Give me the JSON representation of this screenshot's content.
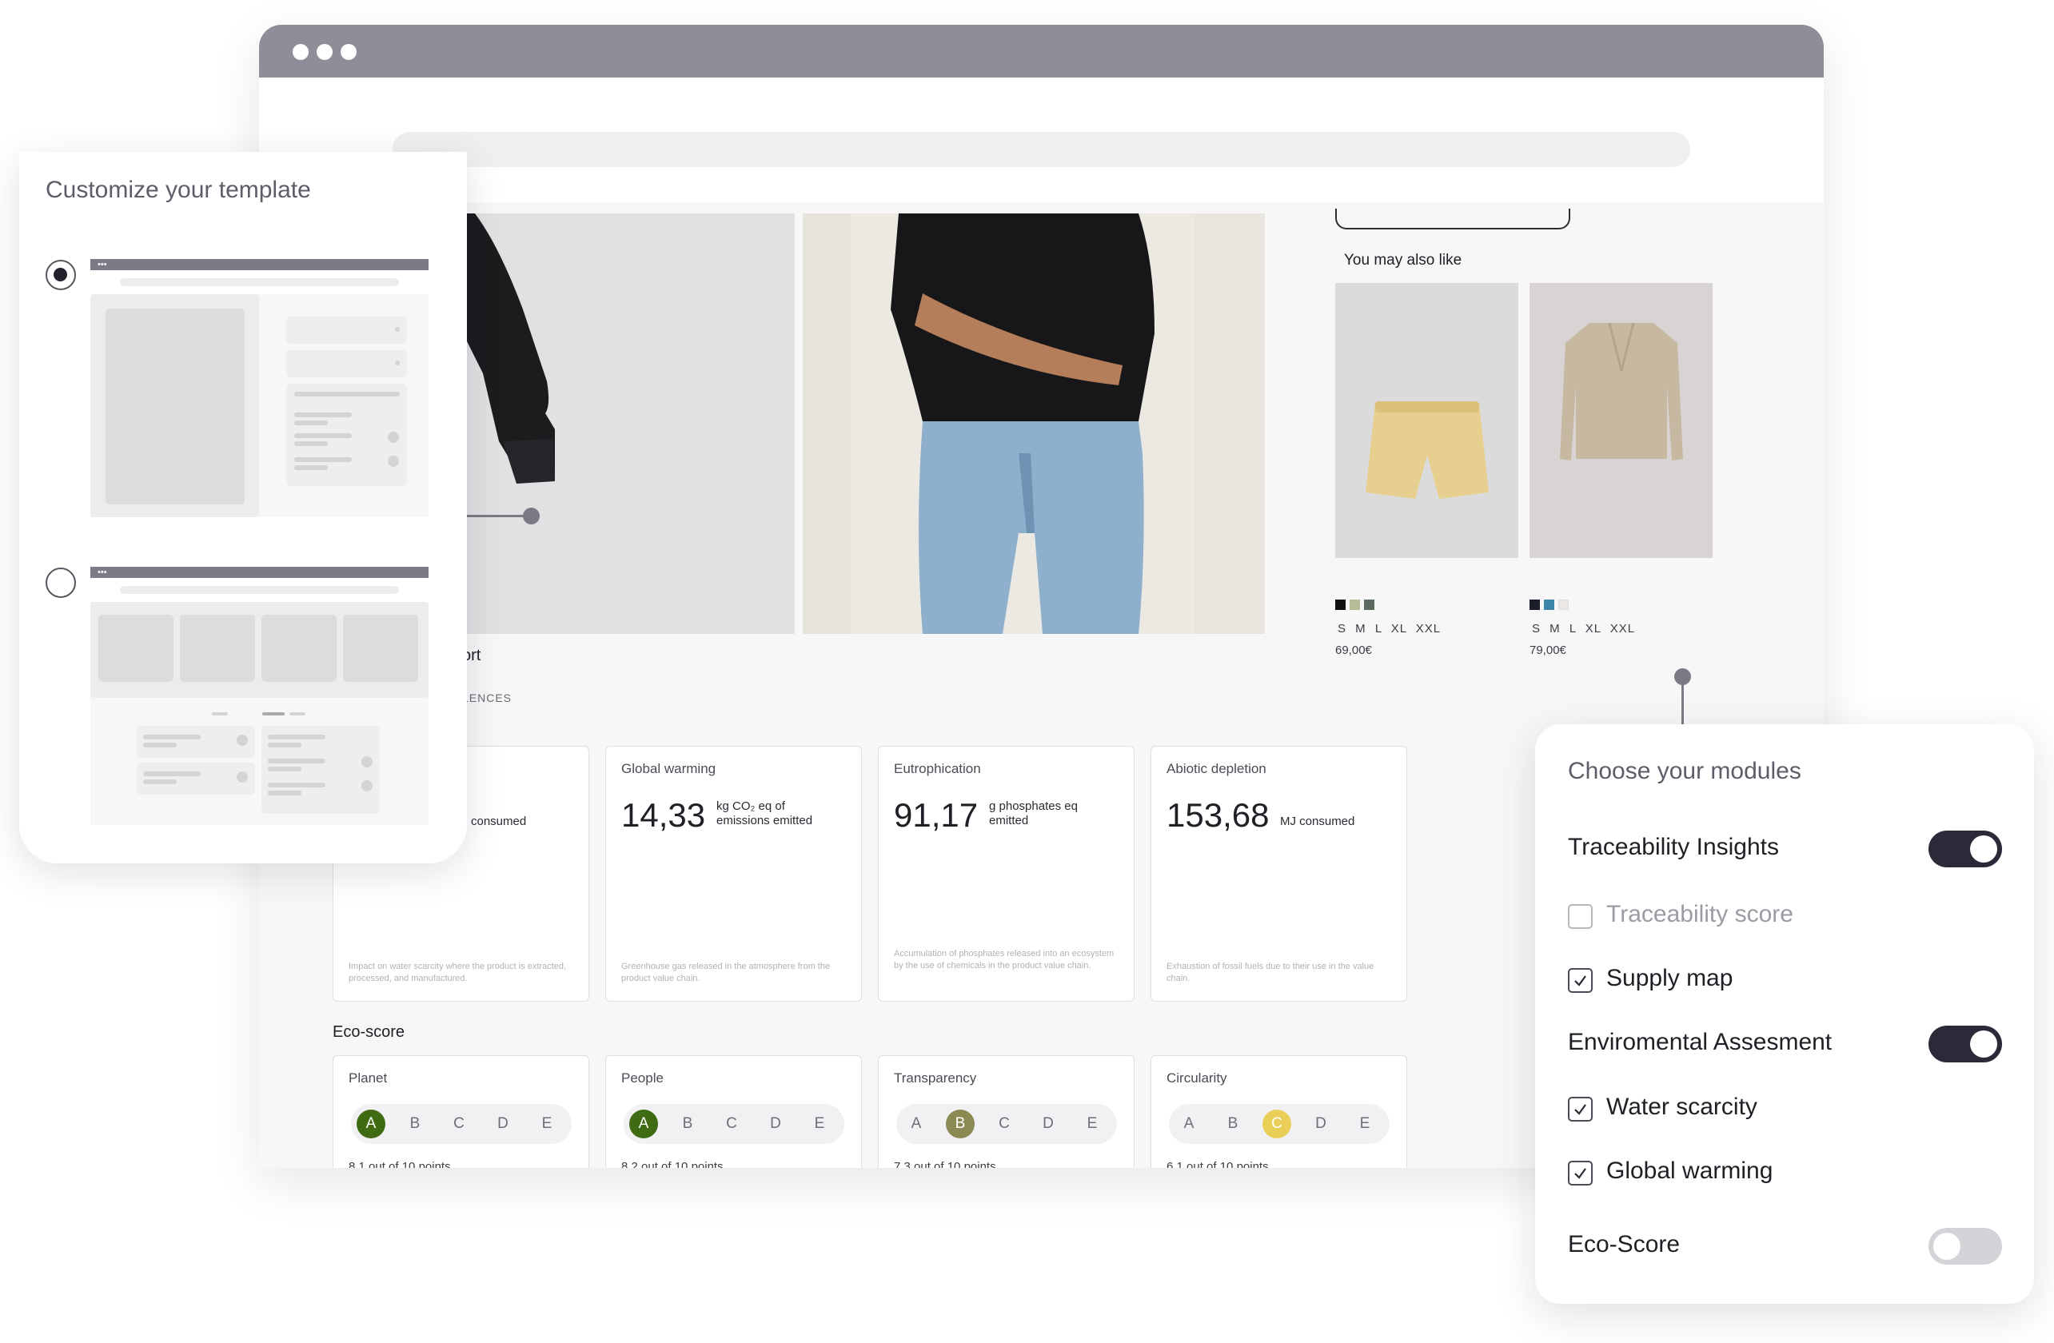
{
  "store": {
    "also_like_title": "You may also like",
    "products": [
      {
        "sizes": "S M L XL XXL",
        "price": "69,00€",
        "swatches": [
          "#111111",
          "#b8bb98",
          "#5d6b5e"
        ]
      },
      {
        "sizes": "S M L XL XXL",
        "price": "79,00€",
        "swatches": [
          "#1b1d2a",
          "#3d86a8",
          "#ebe7e4"
        ]
      }
    ],
    "section_title_fragment": "ort",
    "section_subtitle_fragment": "LENCES"
  },
  "impact": [
    {
      "label": "",
      "value": "",
      "unit": "consumed",
      "description": "Impact on water scarcity where the product is extracted, processed, and manufactured."
    },
    {
      "label": "Global warming",
      "value": "14,33",
      "unit_line1": "kg CO₂ eq of",
      "unit_line2": "emissions emitted",
      "description": "Greenhouse gas released in the atmosphere from the product value chain."
    },
    {
      "label": "Eutrophication",
      "value": "91,17",
      "unit_line1": "g phosphates eq",
      "unit_line2": "emitted",
      "description": "Accumulation of phosphates released into an ecosystem by the use of chemicals in the product value chain."
    },
    {
      "label": "Abiotic depletion",
      "value": "153,68",
      "unit_line1": "MJ consumed",
      "unit_line2": "",
      "description": "Exhaustion of fossil fuels due to their use in the value chain."
    }
  ],
  "eco_score": {
    "title": "Eco-score",
    "grades": [
      "A",
      "B",
      "C",
      "D",
      "E"
    ],
    "cards": [
      {
        "label": "Planet",
        "active": 0,
        "active_color": "#3f6b12",
        "points": "8,1 out of 10 points"
      },
      {
        "label": "People",
        "active": 0,
        "active_color": "#3f6b12",
        "points": "8,2 out of 10 points"
      },
      {
        "label": "Transparency",
        "active": 1,
        "active_color": "#8a8a52",
        "points": "7,3 out of 10 points"
      },
      {
        "label": "Circularity",
        "active": 2,
        "active_color": "#e9cf57",
        "points": "6,1 out of 10 points"
      }
    ]
  },
  "template_panel": {
    "title": "Customize your template",
    "options": [
      {
        "name": "layout-sidebar",
        "checked": true
      },
      {
        "name": "layout-grid",
        "checked": false
      }
    ]
  },
  "modules_panel": {
    "title": "Choose your modules",
    "traceability": {
      "label": "Traceability Insights",
      "on": true
    },
    "traceability_score": {
      "label": "Traceability score",
      "checked": false
    },
    "supply_map": {
      "label": "Supply map",
      "checked": true
    },
    "environmental": {
      "label": "Enviromental Assesment",
      "on": true
    },
    "water_scarcity": {
      "label": "Water scarcity",
      "checked": true
    },
    "global_warming": {
      "label": "Global warming",
      "checked": true
    },
    "eco_score": {
      "label": "Eco-Score",
      "on": false
    }
  },
  "colors": {
    "titlebar": "#8e8e99",
    "toggle_on": "#2a2a38",
    "toggle_off": "#d3d3d8",
    "grade_green": "#3f6b12",
    "grade_olive": "#8a8a52",
    "grade_yellow": "#e9cf57"
  }
}
